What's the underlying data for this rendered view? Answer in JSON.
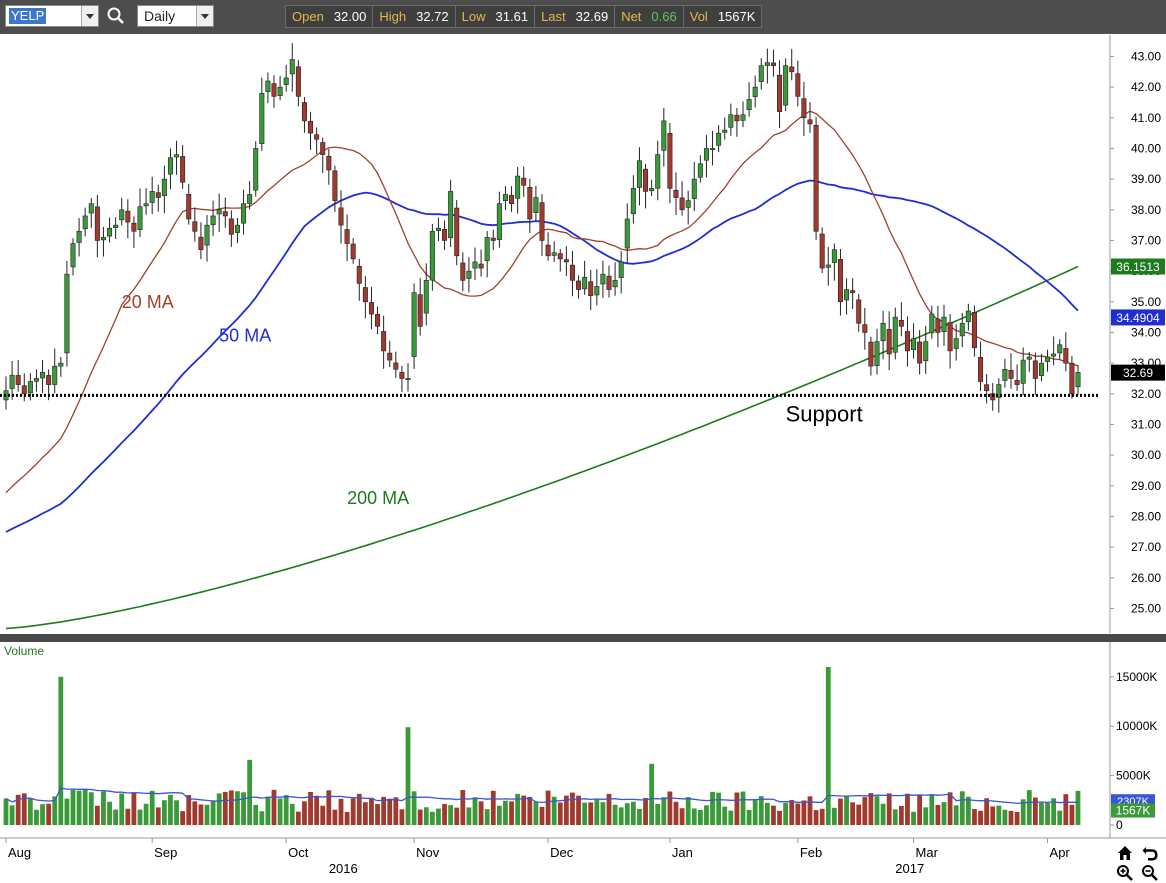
{
  "toolbar": {
    "symbol": "YELP",
    "interval": "Daily",
    "quote": [
      {
        "label": "Open",
        "value": "32.00"
      },
      {
        "label": "High",
        "value": "32.72"
      },
      {
        "label": "Low",
        "value": "31.61"
      },
      {
        "label": "Last",
        "value": "32.69"
      },
      {
        "label": "Net",
        "value": "0.66"
      },
      {
        "label": "Vol",
        "value": "1567K"
      }
    ]
  },
  "colors": {
    "up_candle": "#3a9a3a",
    "down_candle": "#a03a2e",
    "ma20": "#a0402c",
    "ma50": "#1f2ed0",
    "ma200": "#1e7a1e",
    "support": "#000000",
    "volume_avg": "#3a56d0"
  },
  "chart_data": [
    {
      "type": "candlestick",
      "title": "YELP Daily",
      "ylim": [
        24.2,
        43.7
      ],
      "yticks": [
        25,
        26,
        27,
        28,
        29,
        30,
        31,
        32,
        33,
        34,
        35,
        36,
        37,
        38,
        39,
        40,
        41,
        42,
        43
      ],
      "x_month_labels": [
        {
          "label": "Aug",
          "day": 0
        },
        {
          "label": "Sep",
          "day": 24
        },
        {
          "label": "Oct",
          "day": 46
        },
        {
          "label": "Nov",
          "day": 67
        },
        {
          "label": "Dec",
          "day": 89
        },
        {
          "label": "Jan",
          "day": 109
        },
        {
          "label": "Feb",
          "day": 130
        },
        {
          "label": "Mar",
          "day": 149
        },
        {
          "label": "Apr",
          "day": 171
        }
      ],
      "x_year_labels": [
        {
          "label": "2016",
          "day": 53
        },
        {
          "label": "2017",
          "day": 146
        }
      ],
      "ohlc_close": [
        32.1,
        32.6,
        32.3,
        32.0,
        32.4,
        32.5,
        32.7,
        32.3,
        32.9,
        33.0,
        35.9,
        36.9,
        37.3,
        37.8,
        38.2,
        37.0,
        37.1,
        37.4,
        37.5,
        38.0,
        37.6,
        37.3,
        38.1,
        38.2,
        38.6,
        38.4,
        39.0,
        39.7,
        39.8,
        38.9,
        37.7,
        37.3,
        36.7,
        37.5,
        37.8,
        38.0,
        37.8,
        37.2,
        37.5,
        38.2,
        38.5,
        40.0,
        41.8,
        42.2,
        41.7,
        42.0,
        42.3,
        42.9,
        41.7,
        40.9,
        40.5,
        40.3,
        39.8,
        39.3,
        38.3,
        37.5,
        36.9,
        36.4,
        35.6,
        35.0,
        34.6,
        34.2,
        33.4,
        33.1,
        32.8,
        32.5,
        32.5,
        35.3,
        34.2,
        35.7,
        37.3,
        37.4,
        37.0,
        38.6,
        36.5,
        35.7,
        36.0,
        36.3,
        36.1,
        37.1,
        37.0,
        38.2,
        38.5,
        38.2,
        39.1,
        38.8,
        37.7,
        38.4,
        37.0,
        36.5,
        36.6,
        36.4,
        36.3,
        35.7,
        35.4,
        35.8,
        35.2,
        35.5,
        35.9,
        35.4,
        35.7,
        36.3,
        37.7,
        38.7,
        39.6,
        38.6,
        38.7,
        39.8,
        40.9,
        38.7,
        38.4,
        38.0,
        38.3,
        39.0,
        39.5,
        40.0,
        40.0,
        40.5,
        40.6,
        41.1,
        40.9,
        41.1,
        41.6,
        42.0,
        42.7,
        42.8,
        42.7,
        41.2,
        42.7,
        42.5,
        41.7,
        41.0,
        40.8,
        37.3,
        36.1,
        36.2,
        36.7,
        35.0,
        35.4,
        35.3,
        34.3,
        34.0,
        32.9,
        33.7,
        34.3,
        33.3,
        34.5,
        34.2,
        33.4,
        33.8,
        33.0,
        33.7,
        34.6,
        34.0,
        34.5,
        33.4,
        33.8,
        34.3,
        34.7,
        33.5,
        32.4,
        32.1,
        31.8,
        32.3,
        32.8,
        32.5,
        32.3,
        33.1,
        33.2,
        32.5,
        33.0,
        33.2,
        33.3,
        33.6,
        33.0,
        32.0,
        32.7
      ],
      "series": [
        {
          "name": "20 MA",
          "color": "#a0402c",
          "label_pos": "left"
        },
        {
          "name": "50 MA",
          "color": "#1f2ed0",
          "last_value": "34.4904"
        },
        {
          "name": "200 MA",
          "color": "#1e7a1e",
          "last_value": "36.1513"
        }
      ],
      "price_tags": [
        {
          "value": "36.1513",
          "color": "#1e7a1e"
        },
        {
          "value": "34.4904",
          "color": "#1f2ed0"
        },
        {
          "value": "32.69",
          "color": "#000000"
        }
      ],
      "support": {
        "label": "Support",
        "value": 31.95
      }
    },
    {
      "type": "bar",
      "title": "Volume",
      "ylim": [
        0,
        16500
      ],
      "yticks": [
        {
          "value": 0,
          "label": "0"
        },
        {
          "value": 5000,
          "label": "5000K"
        },
        {
          "value": 10000,
          "label": "10000K"
        },
        {
          "value": 15000,
          "label": "15000K"
        }
      ],
      "last_value": "1567K",
      "avg_value": "2307K",
      "spike_values": [
        {
          "day": 9,
          "value": 15000
        },
        {
          "day": 40,
          "value": 6600
        },
        {
          "day": 66,
          "value": 9900
        },
        {
          "day": 106,
          "value": 6200
        },
        {
          "day": 135,
          "value": 16000
        }
      ]
    }
  ]
}
